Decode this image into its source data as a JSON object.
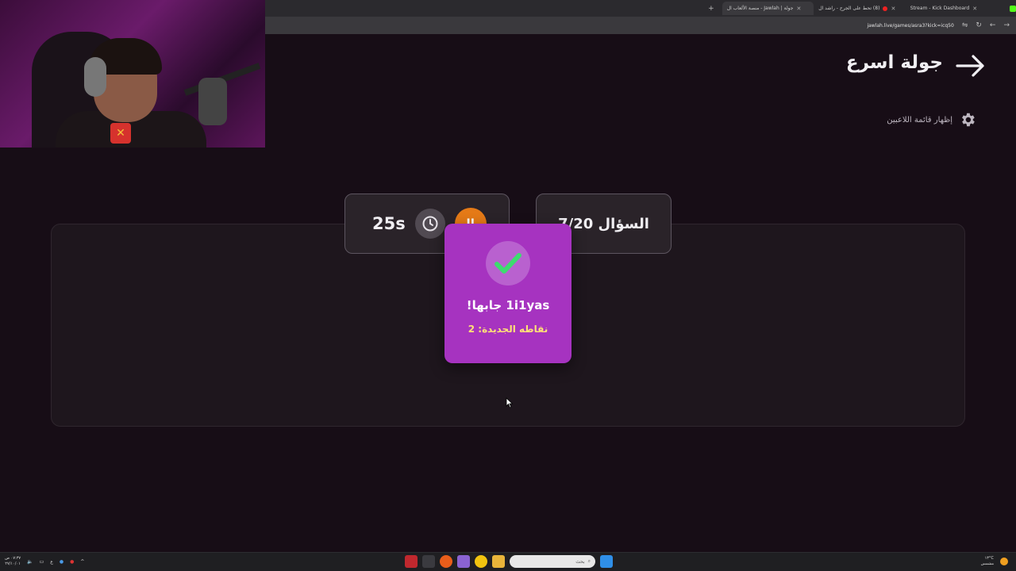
{
  "browser": {
    "tabs": [
      {
        "title": "جولة | Jawlah - منصة الألعاب ال",
        "active": true
      },
      {
        "title": "(8) تحط على الجرح - راشد ال",
        "active": false
      },
      {
        "title": "Stream - Kick Dashboard",
        "active": false
      }
    ],
    "url": "jawlah.live/games/asra3?kick=icq50"
  },
  "page": {
    "title": "جولة اسرع",
    "settings_label": "إظهار قائمة اللاعبين",
    "timer": "25s",
    "question_counter": "السؤال 7/20"
  },
  "popup": {
    "title": "1i1yas جابها!",
    "points": "نقاطه الجديدة: 2"
  },
  "taskbar": {
    "time": "٠٧:٣٧ ص",
    "date": "٢٧/١٠/٠١",
    "lang": "ع",
    "search_placeholder": "بحث",
    "weather_temp": "١٣°C",
    "weather_text": "مشمس"
  },
  "colors": {
    "background": "#170d16",
    "popup": "#a633c0",
    "accent_orange": "#e57a17",
    "check_green": "#3ddc6f"
  }
}
